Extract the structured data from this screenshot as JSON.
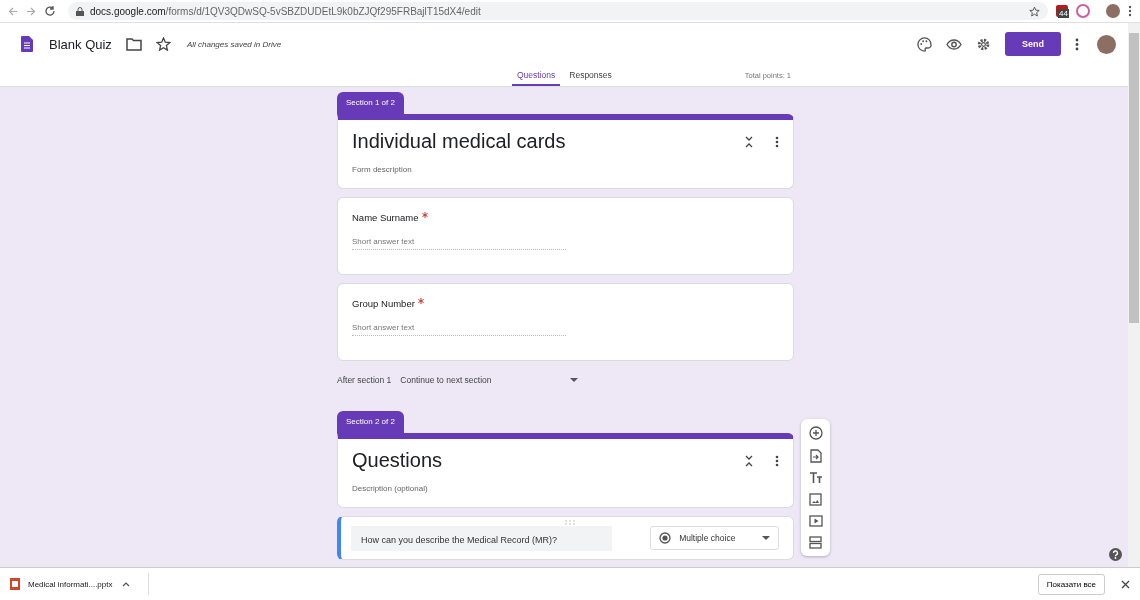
{
  "browser": {
    "url_host": "docs.google.com",
    "url_path": "/forms/d/1QV3QDwSQ-5vSBZDUDEtL9k0bZJQf295FRBajlT15dX4/edit",
    "extension_badge": "44"
  },
  "header": {
    "title": "Blank Quiz",
    "save_status": "All changes saved in Drive",
    "send": "Send",
    "total_points": "Total points: 1",
    "tabs": [
      {
        "label": "Questions",
        "selected": true
      },
      {
        "label": "Responses",
        "selected": false
      }
    ]
  },
  "sections": [
    {
      "tab": "Section 1 of 2",
      "title": "Individual medical cards",
      "description": "Form description",
      "questions": [
        {
          "kind": "short",
          "title": "Name Surname",
          "required": true,
          "placeholder": "Short answer text"
        },
        {
          "kind": "short",
          "title": "Group Number",
          "required": true,
          "placeholder": "Short answer text"
        }
      ],
      "after": {
        "label": "After section 1",
        "value": "Continue to next section"
      }
    },
    {
      "tab": "Section 2 of 2",
      "title": "Questions",
      "description": "Description (optional)",
      "questions": [
        {
          "kind": "editing",
          "title": "How can you describe the Medical Record (MR)?",
          "type": "Multiple choice"
        }
      ]
    }
  ],
  "downloads": {
    "file": "Medical informati....pptx",
    "show_all": "Показати все"
  }
}
